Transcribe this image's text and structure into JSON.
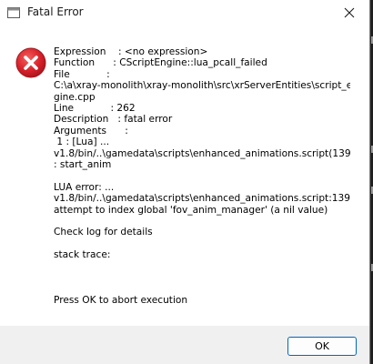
{
  "window": {
    "title": "Fatal Error",
    "title_icon": "app-window-icon",
    "close_icon": "close-icon"
  },
  "message": {
    "icon": "error-x-icon",
    "icon_color": "#d9212b",
    "lines": [
      "Expression    : <no expression>",
      "Function      : CScriptEngine::lua_pcall_failed",
      "File            :",
      "C:\\a\\xray-monolith\\xray-monolith\\src\\xrServerEntities\\script_en",
      "gine.cpp",
      "Line            : 262",
      "Description   : fatal error",
      "Arguments      :",
      " 1 : [Lua] ...",
      "v1.8/bin/..\\gamedata\\scripts\\enhanced_animations.script(139)",
      ": start_anim",
      "",
      "LUA error: ...",
      "v1.8/bin/..\\gamedata\\scripts\\enhanced_animations.script:139:",
      "attempt to index global 'fov_anim_manager' (a nil value)",
      "",
      "Check log for details",
      "",
      "stack trace:",
      "",
      "",
      "",
      "Press OK to abort execution"
    ]
  },
  "footer": {
    "ok_label": "OK",
    "ok_border_color": "#0067c0"
  }
}
